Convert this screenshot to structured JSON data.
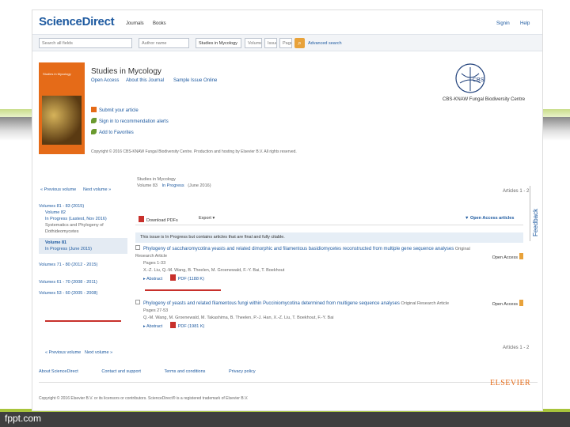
{
  "slide": {
    "footer": "fppt.com"
  },
  "topbar": {
    "logo": "ScienceDirect",
    "nav": [
      "Journals",
      "Books"
    ],
    "right": [
      "Signin",
      "Help"
    ]
  },
  "search": {
    "all_fields": "Search all fields",
    "author": "Author name",
    "journal": "Studies in Mycology",
    "volume": "Volume",
    "issue": "Issue",
    "page": "Page",
    "advanced": "Advanced search"
  },
  "journal": {
    "title": "Studies in Mycology",
    "links": [
      "Open Access",
      "About this Journal",
      "Sample Issue Online"
    ],
    "sidebar": [
      "Submit your article",
      "Sign in to recommendation alerts",
      "Add to Favorites"
    ],
    "society": "CBS-KNAW Fungal Biodiversity Centre",
    "copyright": "Copyright © 2016 CBS-KNAW Fungal Biodiversity Centre. Production and hosting by Elsevier B.V. All rights reserved."
  },
  "crumbs": {
    "line1": "Studies in Mycology",
    "line2_a": "Volume 83",
    "line2_b": "In Progress",
    "line2_c": "(June 2016)"
  },
  "nav": {
    "prev": "« Previous volume",
    "next": "Next volume »",
    "prev_bottom": "« Previous volume",
    "next_bottom": "Next volume »",
    "articles_top": "Articles 1 - 2",
    "articles_bottom": "Articles 1 - 2"
  },
  "left_nav": {
    "head1": "Volumes 81 - 83 (2015)",
    "vol82": "Volume 82",
    "in_progress": "In Progress (Lastest, Nov 2016)",
    "special": "Systematics and Phylogeny of Dothideomycetes",
    "vol81_label": "Volume 81",
    "vol81_sub": "In Progress (June 2015)",
    "head2": "Volumes 71 - 80 (2012 - 2015)",
    "head3": "Volumes 61 - 70 (2008 - 2011)",
    "head4": "Volumes 53 - 60 (2005 - 2008)"
  },
  "toolbar": {
    "download": "Download PDFs",
    "export": "Export",
    "filter": "Open Access articles"
  },
  "notice": "This issue is In Progress but contains articles that are final and fully citable.",
  "articles": [
    {
      "title": "Phylogeny of saccharomycotina yeasts and related dimorphic and filamentous basidiomycetes reconstructed from multiple gene sequence analyses",
      "type": "Original Research Article",
      "pages": "Pages 1-33",
      "authors": "X.-Z. Liu, Q.-M. Wang, B. Theelen, M. Groenewald, F.-Y. Bai, T. Boekhout",
      "abstract": "Abstract",
      "pdf": "PDF (1188 K)",
      "access": "Open Access"
    },
    {
      "title": "Phylogeny of yeasts and related filamentous fungi within Pucciniomycotina determined from multigene sequence analyses",
      "type": "Original Research Article",
      "pages": "Pages 27-53",
      "authors": "Q.-M. Wang, M. Groenewald, M. Takashima, B. Theelen, P.-J. Han, X.-Z. Liu, T. Boekhout, F.-Y. Bai",
      "abstract": "Abstract",
      "pdf": "PDF (1981 K)",
      "access": "Open Access"
    }
  ],
  "feedback": "Feedback",
  "footer": {
    "links": [
      "About ScienceDirect",
      "Contact and support",
      "Terms and conditions",
      "Privacy policy"
    ],
    "copy": "Copyright © 2016 Elsevier B.V. or its licensors or contributors. ScienceDirect® is a registered trademark of Elsevier B.V.",
    "brand": "ELSEVIER"
  },
  "colors": {
    "link": "#1e5aa0",
    "accent": "#e56b18",
    "highlight": "#c8302b"
  }
}
